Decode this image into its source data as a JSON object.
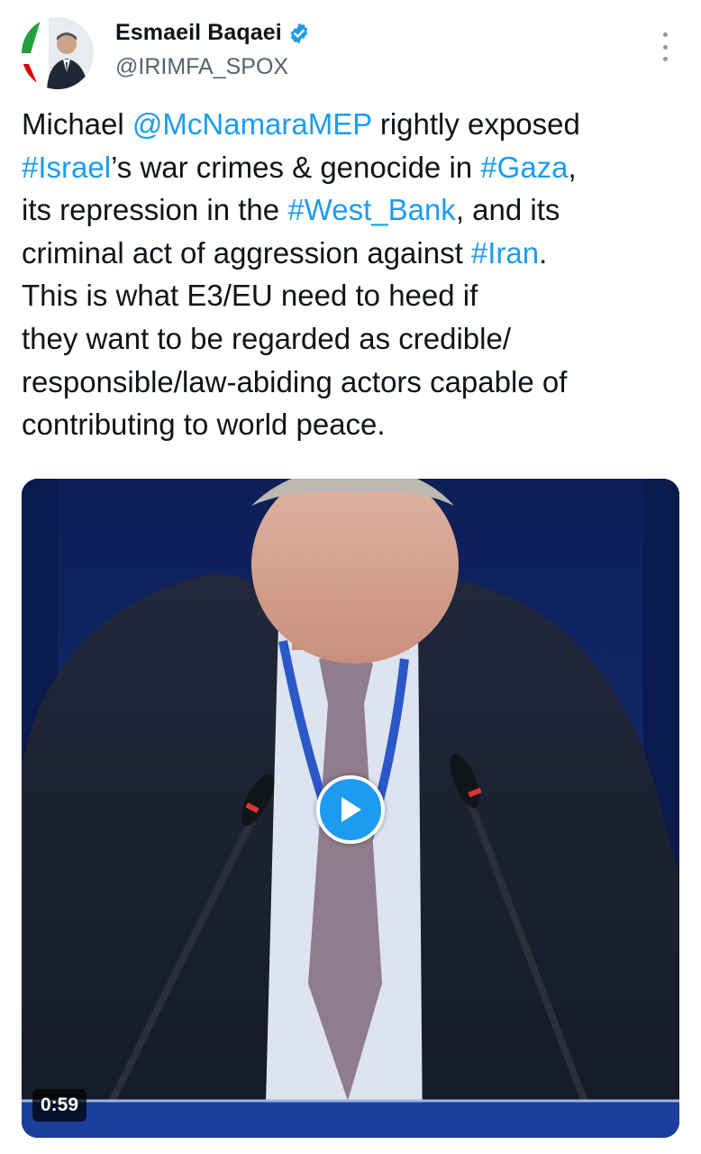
{
  "author": {
    "display_name": "Esmaeil Baqaei",
    "handle": "@IRIMFA_SPOX",
    "verified": true,
    "avatar_icon": "profile-photo-with-iran-flag"
  },
  "tweet": {
    "segments": [
      {
        "text": "Michael ",
        "link": false
      },
      {
        "text": "@McNamaraMEP",
        "link": true
      },
      {
        "text": " rightly exposed\n",
        "link": false
      },
      {
        "text": "#Israel",
        "link": true
      },
      {
        "text": "’s war crimes & genocide in ",
        "link": false
      },
      {
        "text": "#Gaza",
        "link": true
      },
      {
        "text": ",\nits repression in the ",
        "link": false
      },
      {
        "text": "#West_Bank",
        "link": true
      },
      {
        "text": ", and its\ncriminal act of aggression against ",
        "link": false
      },
      {
        "text": "#Iran",
        "link": true
      },
      {
        "text": ".\nThis is what E3/EU need to heed if\nthey want to be regarded as credible/\nresponsible/law-abiding actors capable of\ncontributing to world peace.",
        "link": false
      }
    ]
  },
  "media": {
    "type": "video",
    "duration": "0:59",
    "play_icon": "play-icon"
  },
  "colors": {
    "link": "#1d9bf0",
    "text": "#0f1419",
    "secondary": "#536471",
    "verified": "#1d9bf0"
  }
}
